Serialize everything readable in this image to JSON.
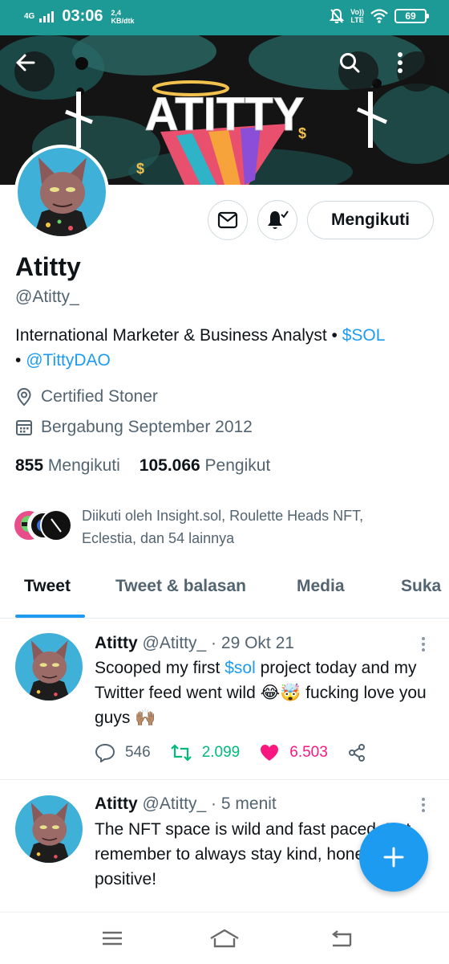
{
  "status_bar": {
    "network": "4G",
    "time": "03:06",
    "speed_value": "2,4",
    "speed_unit": "KB/dtk",
    "volte": "Vo))",
    "lte": "LTE",
    "battery": "69"
  },
  "banner": {
    "title_art": "ATITTY"
  },
  "profile": {
    "follow_label": "Mengikuti",
    "display_name": "Atitty",
    "handle": "@Atitty_",
    "bio_text": "International Marketer & Business Analyst • ",
    "bio_link_sol": "$SOL",
    "bio_sep": "• ",
    "bio_link_dao": "@TittyDAO",
    "location": "Certified Stoner",
    "joined": "Bergabung September 2012",
    "following_count": "855",
    "following_label": "Mengikuti",
    "followers_count": "105.066",
    "followers_label": "Pengikut",
    "followed_by": "Diikuti oleh Insight.sol, Roulette Heads NFT, Eclestia, dan 54 lainnya"
  },
  "tabs": [
    "Tweet",
    "Tweet & balasan",
    "Media",
    "Suka"
  ],
  "tweets": [
    {
      "name": "Atitty",
      "handle": "@Atitty_",
      "sep": "·",
      "time": "29 Okt 21",
      "text_before": "Scooped my first ",
      "text_link": "$sol",
      "text_after": " project today and my Twitter feed went wild 😂🤯 fucking love you guys 🙌🏽",
      "replies": "546",
      "retweets": "2.099",
      "likes": "6.503"
    },
    {
      "name": "Atitty",
      "handle": "@Atitty_",
      "sep": "·",
      "time": "5 menit",
      "text": "The NFT space is wild and fast paced. But remember to always stay kind, honest, and positive!"
    }
  ],
  "colors": {
    "status_bar": "#1e9a96",
    "accent": "#1d9bf0",
    "retweet": "#00ba7c",
    "like": "#f91880",
    "secondary_text": "#536471"
  }
}
